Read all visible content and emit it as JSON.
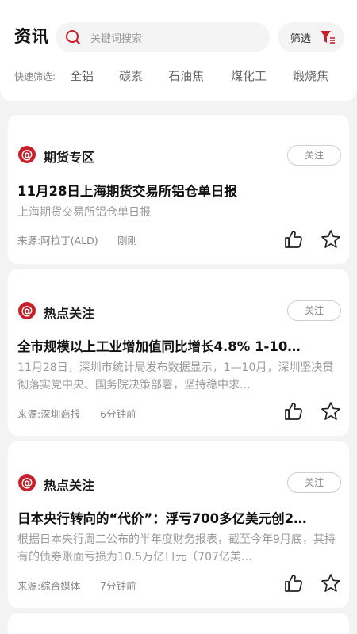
{
  "header": {
    "title": "资讯",
    "search_placeholder": "关键词搜索",
    "filter_label": "筛选",
    "quick_filter_label": "快速筛选:",
    "quick_filters": [
      "全铝",
      "碳素",
      "石油焦",
      "煤化工",
      "煅烧焦"
    ]
  },
  "cards": [
    {
      "category": "期货专区",
      "follow_label": "关注",
      "headline": "11月28日上海期货交易所铝仓单日报",
      "summary": "上海期货交易所铝仓单日报",
      "source": "来源:阿拉丁(ALD)",
      "time": "刚刚"
    },
    {
      "category": "热点关注",
      "follow_label": "关注",
      "headline": "全市规模以上工业增加值同比增长4.8% 1-10…",
      "summary": "11月28日，深圳市统计局发布数据显示，1—10月，深圳坚决贯彻落实党中央、国务院决策部署，坚持稳中求…",
      "source": "来源:深圳商报",
      "time": "6分钟前"
    },
    {
      "category": "热点关注",
      "follow_label": "关注",
      "headline": "日本央行转向的“代价”：浮亏700多亿美元创2…",
      "summary": "根据日本央行周二公布的半年度财务报表，截至今年9月底，其持有的债券账面亏损为10.5万亿日元（707亿美…",
      "source": "来源:综合媒体",
      "time": "7分钟前"
    }
  ],
  "colors": {
    "accent": "#c8202a",
    "background": "#f3f3f3",
    "card": "#ffffff"
  }
}
